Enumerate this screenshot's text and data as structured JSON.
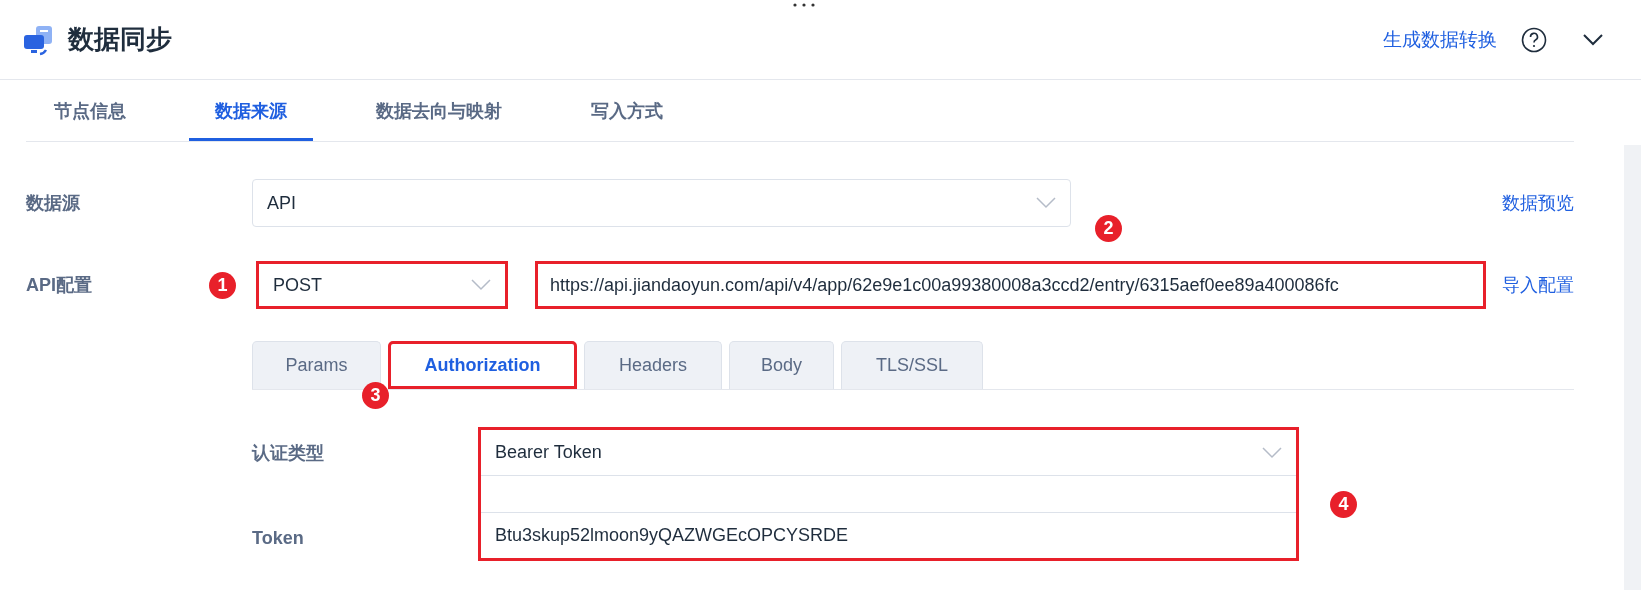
{
  "header": {
    "title": "数据同步",
    "link": "生成数据转换"
  },
  "tabs": [
    {
      "label": "节点信息",
      "selected": false
    },
    {
      "label": "数据来源",
      "selected": true
    },
    {
      "label": "数据去向与映射",
      "selected": false
    },
    {
      "label": "写入方式",
      "selected": false
    }
  ],
  "source": {
    "label": "数据源",
    "value": "API",
    "link": "数据预览",
    "badge": "2"
  },
  "api": {
    "label": "API配置",
    "method": {
      "value": "POST",
      "highlighted": true,
      "badge": "1"
    },
    "url": {
      "value": "https://api.jiandaoyun.com/api/v4/app/62e9e1c00a99380008a3ccd2/entry/6315aef0ee89a400086fc",
      "highlighted": true
    },
    "link": "导入配置"
  },
  "subtabs": [
    {
      "label": "Params",
      "selected": false,
      "highlighted": false
    },
    {
      "label": "Authorization",
      "selected": true,
      "highlighted": true,
      "badge": "3"
    },
    {
      "label": "Headers",
      "selected": false,
      "highlighted": false
    },
    {
      "label": "Body",
      "selected": false,
      "highlighted": false
    },
    {
      "label": "TLS/SSL",
      "selected": false,
      "highlighted": false
    }
  ],
  "auth": {
    "highlighted": true,
    "badge": "4",
    "type_label": "认证类型",
    "type_value": "Bearer Token",
    "token_label": "Token",
    "token_value": "Btu3skup52lmoon9yQAZWGEcOPCYSRDE"
  }
}
